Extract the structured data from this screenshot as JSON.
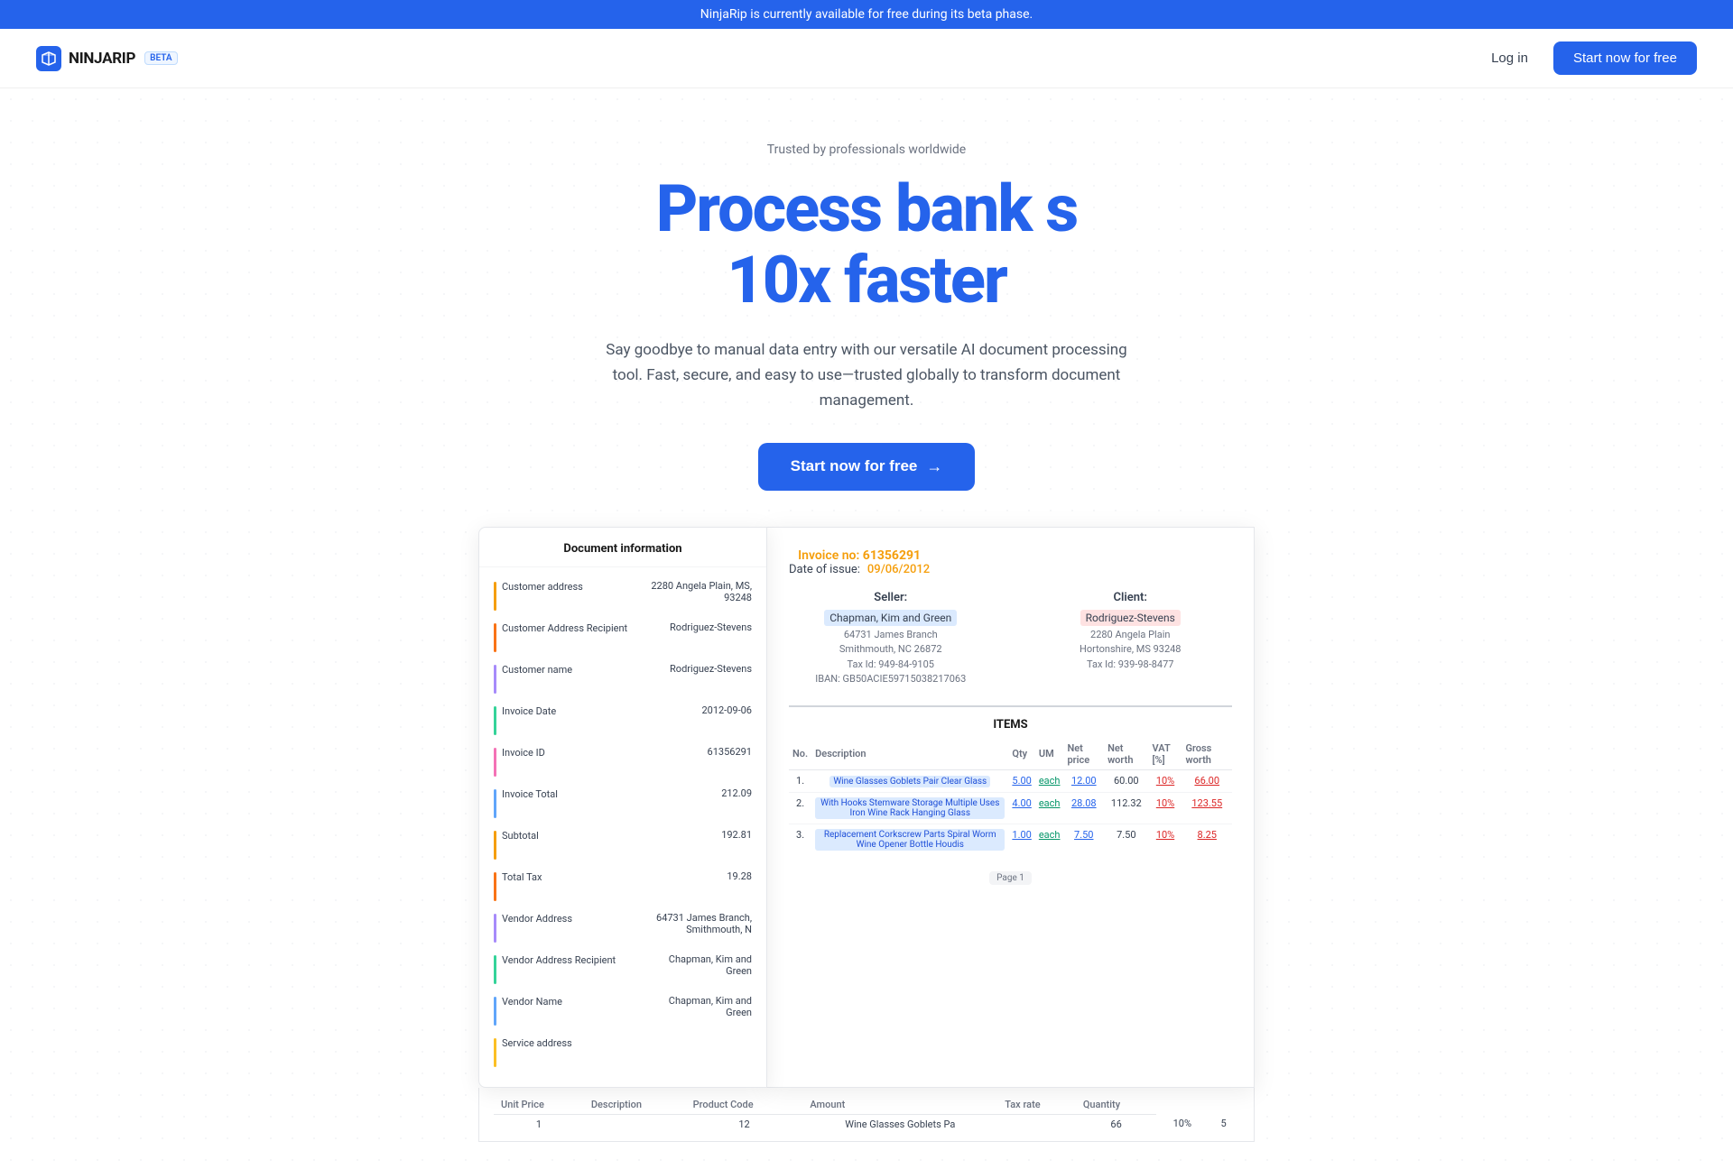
{
  "banner": {
    "text": "NinjaRip is currently available for free during its beta phase."
  },
  "nav": {
    "logo_text": "NINJARIP",
    "logo_beta": "BETA",
    "login_label": "Log in",
    "start_label": "Start now for free"
  },
  "hero": {
    "trusted_text": "Trusted by professionals worldwide",
    "title_line1": "Process bank s",
    "title_line2": "10x faster",
    "subtitle": "Say goodbye to manual data entry with our versatile AI document processing tool. Fast, secure, and easy to use—trusted globally to transform document management.",
    "cta_label": "Start now for free",
    "cta_arrow": "→"
  },
  "doc_panel": {
    "title": "Document information",
    "fields": [
      {
        "label": "Customer address",
        "value": "2280 Angela Plain, MS, 93248",
        "color": "#f59e0b"
      },
      {
        "label": "Customer Address Recipient",
        "value": "Rodriguez-Stevens",
        "color": "#f97316"
      },
      {
        "label": "Customer name",
        "value": "Rodriguez-Stevens",
        "color": "#a78bfa"
      },
      {
        "label": "Invoice Date",
        "value": "2012-09-06",
        "color": "#34d399"
      },
      {
        "label": "Invoice ID",
        "value": "61356291",
        "color": "#f472b6"
      },
      {
        "label": "Invoice Total",
        "value": "212.09",
        "color": "#60a5fa"
      },
      {
        "label": "Subtotal",
        "value": "192.81",
        "color": "#f59e0b"
      },
      {
        "label": "Total Tax",
        "value": "19.28",
        "color": "#f97316"
      },
      {
        "label": "Vendor Address",
        "value": "64731 James Branch, Smithmouth, N",
        "color": "#a78bfa"
      },
      {
        "label": "Vendor Address Recipient",
        "value": "Chapman, Kim and Green",
        "color": "#34d399"
      },
      {
        "label": "Vendor Name",
        "value": "Chapman, Kim and Green",
        "color": "#60a5fa"
      },
      {
        "label": "Service address",
        "value": "",
        "color": "#fbbf24"
      }
    ]
  },
  "invoice": {
    "invoice_no_label": "Invoice no:",
    "invoice_no_value": "61356291",
    "date_label": "Date of issue:",
    "date_value": "09/06/2012",
    "seller_label": "Seller:",
    "seller_name": "Chapman, Kim and Green",
    "seller_address1": "64731 James Branch",
    "seller_address2": "Smithmouth, NC 26872",
    "seller_tax": "Tax Id: 949-84-9105",
    "seller_iban": "IBAN: GB50ACIE59715038217063",
    "client_label": "Client:",
    "client_name": "Rodriguez-Stevens",
    "client_address1": "2280 Angela Plain",
    "client_address2": "Hortonshire, MS 93248",
    "client_tax": "Tax Id: 939-98-8477",
    "items_title": "ITEMS",
    "table_headers": [
      "No.",
      "Description",
      "Qty",
      "UM",
      "Net price",
      "Net worth",
      "VAT [%]",
      "Gross worth"
    ],
    "items": [
      {
        "no": "1.",
        "desc": "Wine Glasses Goblets Pair Clear Glass",
        "qty": "5.00",
        "um": "each",
        "net_price": "12.00",
        "net_worth": "60.00",
        "vat": "10%",
        "gross": "66.00"
      },
      {
        "no": "2.",
        "desc": "With Hooks Stemware Storage Multiple Uses Iron Wine Rack Hanging Glass",
        "qty": "4.00",
        "um": "each",
        "net_price": "28.08",
        "net_worth": "112.32",
        "vat": "10%",
        "gross": "123.55"
      },
      {
        "no": "3.",
        "desc": "Replacement Corkscrew Parts Spiral Worm Wine Opener Bottle Houdis",
        "qty": "1.00",
        "um": "each",
        "net_price": "7.50",
        "net_worth": "7.50",
        "vat": "10%",
        "gross": "8.25"
      }
    ],
    "page_badge": "Page 1",
    "bottom_headers": [
      "Unit Price",
      "Description",
      "Product Code",
      "Amount",
      "Tax rate",
      "Quantity"
    ],
    "bottom_row": [
      "12",
      "Wine Glasses Goblets Pa",
      "",
      "66",
      "10%",
      "5"
    ]
  }
}
